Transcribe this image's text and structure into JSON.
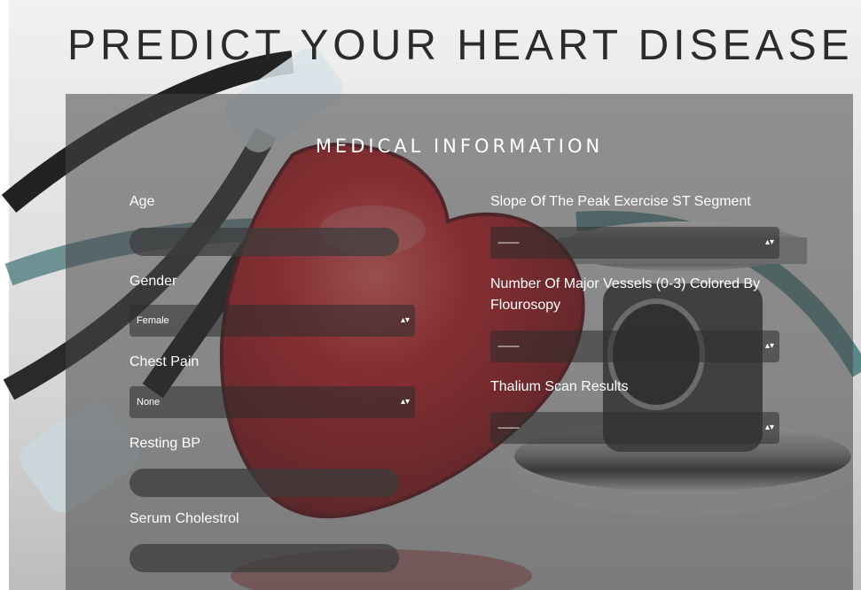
{
  "page": {
    "title": "PREDICT YOUR HEART DISEASE"
  },
  "form": {
    "section_title": "MEDICAL INFORMATION",
    "left": {
      "age": {
        "label": "Age",
        "value": ""
      },
      "gender": {
        "label": "Gender",
        "selected": "Female"
      },
      "chest_pain": {
        "label": "Chest Pain",
        "selected": "None"
      },
      "resting_bp": {
        "label": "Resting BP",
        "value": ""
      },
      "serum_cholestrol": {
        "label": "Serum Cholestrol",
        "value": ""
      }
    },
    "right": {
      "slope": {
        "label": "Slope Of The Peak Exercise ST Segment",
        "selected": "---------"
      },
      "major_vessels": {
        "label": "Number Of Major Vessels (0-3) Colored By Flourosopy",
        "selected": "---------"
      },
      "thalium": {
        "label": "Thalium Scan Results",
        "selected": "---------"
      }
    }
  },
  "icons": {
    "select_arrows": "▴▾"
  },
  "colors": {
    "heart": "#c0141c",
    "panel": "#464646",
    "title": "#2b2b2b"
  }
}
